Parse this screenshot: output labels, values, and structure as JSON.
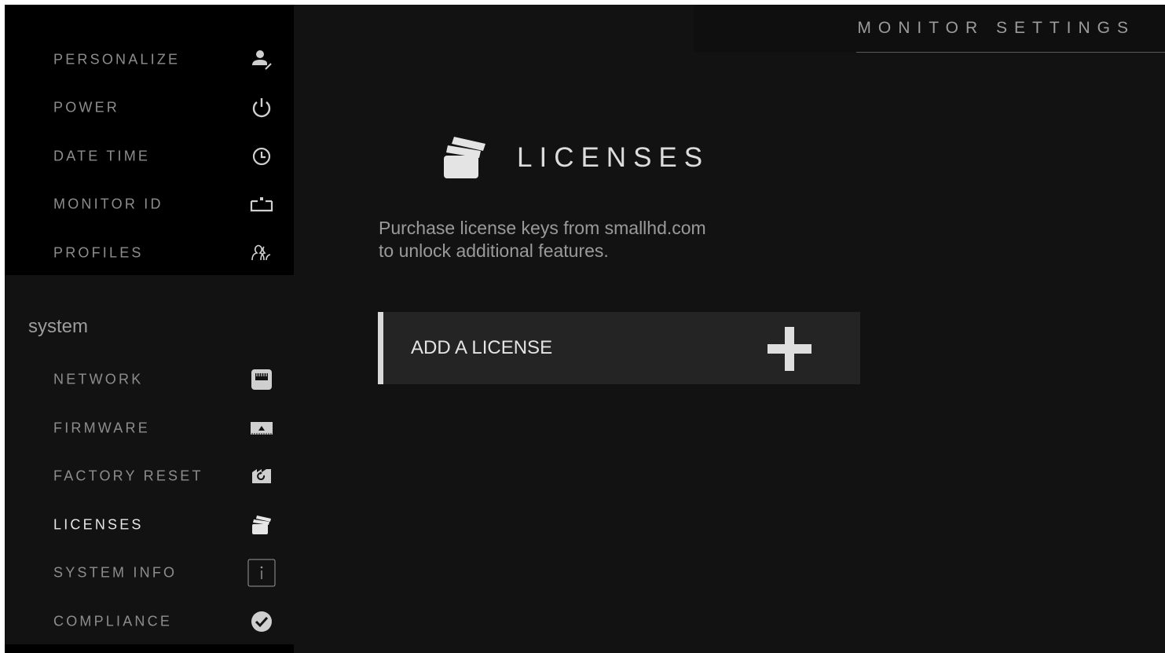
{
  "header": {
    "title": "MONITOR SETTINGS"
  },
  "sidebar": {
    "top_items": [
      {
        "label": "PERSONALIZE",
        "icon": "person-edit-icon"
      },
      {
        "label": "POWER",
        "icon": "power-icon"
      },
      {
        "label": "DATE TIME",
        "icon": "clock-icon"
      },
      {
        "label": "MONITOR ID",
        "icon": "id-tray-icon"
      },
      {
        "label": "PROFILES",
        "icon": "profiles-icon"
      }
    ],
    "section_label": "system",
    "system_items": [
      {
        "label": "NETWORK",
        "icon": "network-port-icon"
      },
      {
        "label": "FIRMWARE",
        "icon": "firmware-chip-icon"
      },
      {
        "label": "FACTORY RESET",
        "icon": "factory-reset-icon"
      },
      {
        "label": "LICENSES",
        "icon": "licenses-cards-icon",
        "active": true
      },
      {
        "label": "SYSTEM INFO",
        "icon": "info-icon"
      },
      {
        "label": "COMPLIANCE",
        "icon": "check-circle-icon"
      }
    ]
  },
  "main": {
    "title": "LICENSES",
    "title_icon": "licenses-cards-icon",
    "description_line1": "Purchase license keys from smallhd.com",
    "description_line2": "to unlock additional features.",
    "add_button_label": "ADD A LICENSE",
    "add_button_icon": "plus-icon"
  },
  "colors": {
    "background": "#121212",
    "sidebar_top": "#000000",
    "row_background": "#242424",
    "text_dim": "#8d8d8d",
    "text_bright": "#e6e6e6"
  }
}
